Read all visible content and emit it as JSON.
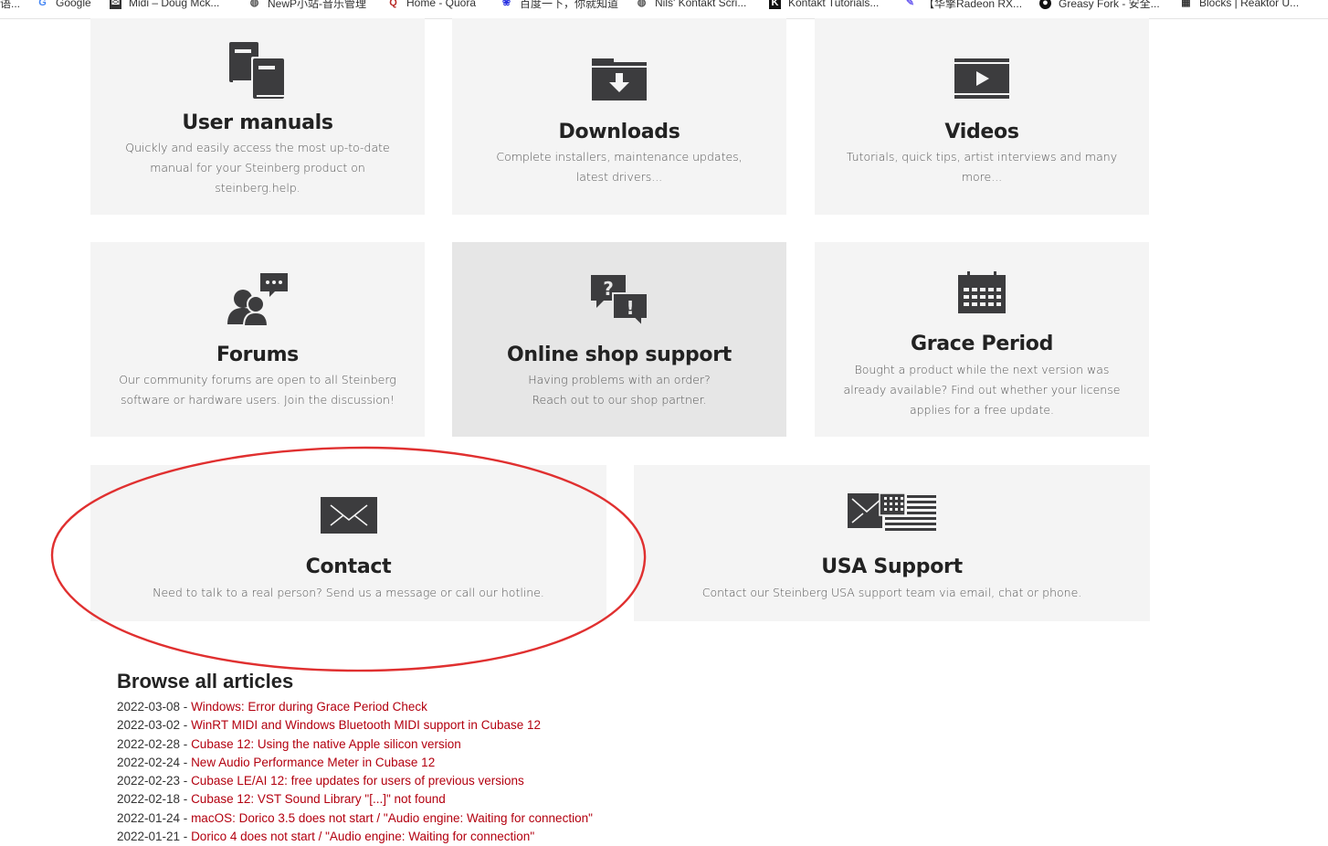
{
  "bookmarks": [
    {
      "icon": "generic-icon",
      "label": "语..."
    },
    {
      "icon": "google-icon",
      "label": "Google"
    },
    {
      "icon": "mail-icon",
      "label": "Midi – Doug Mck..."
    },
    {
      "icon": "globe-icon",
      "label": "NewP小站-音乐管理"
    },
    {
      "icon": "quora-icon",
      "label": "Home - Quora"
    },
    {
      "icon": "paw-icon",
      "label": "百度一下，你就知道"
    },
    {
      "icon": "globe-icon",
      "label": "Nils' Kontakt Scri..."
    },
    {
      "icon": "kontakt-icon",
      "label": "Kontakt Tutorials..."
    },
    {
      "icon": "pen-icon",
      "label": "【华擎Radeon RX..."
    },
    {
      "icon": "monkey-icon",
      "label": "Greasy Fork - 安全..."
    },
    {
      "icon": "blocks-icon",
      "label": "Blocks | Reaktor U..."
    }
  ],
  "cards": {
    "user_manuals": {
      "title": "User manuals",
      "desc": "Quickly and easily access the most up-to-date manual for your Steinberg product on steinberg.help."
    },
    "downloads": {
      "title": "Downloads",
      "desc": "Complete installers, maintenance updates, latest drivers..."
    },
    "videos": {
      "title": "Videos",
      "desc": "Tutorials, quick tips, artist interviews and many more..."
    },
    "forums": {
      "title": "Forums",
      "desc": "Our community forums are open to all Steinberg software or hardware users. Join the discussion!"
    },
    "shop": {
      "title": "Online shop support",
      "desc": "Having problems with an order? Reach out to our shop partner."
    },
    "grace": {
      "title": "Grace Period",
      "desc": "Bought a product while the next version was already available? Find out whether your license applies for a free update."
    },
    "contact": {
      "title": "Contact",
      "desc": "Need to talk to a real person? Send us a message or call our hotline."
    },
    "usa": {
      "title": "USA Support",
      "desc": "Contact our Steinberg USA support team via email, chat or phone."
    }
  },
  "articles": {
    "heading": "Browse all articles",
    "items": [
      {
        "date": "2022-03-08 - ",
        "title": "Windows: Error during Grace Period Check"
      },
      {
        "date": "2022-03-02 - ",
        "title": "WinRT MIDI and Windows Bluetooth MIDI support in Cubase 12"
      },
      {
        "date": "2022-02-28 - ",
        "title": "Cubase 12: Using the native Apple silicon version"
      },
      {
        "date": "2022-02-24 - ",
        "title": "New Audio Performance Meter in Cubase 12"
      },
      {
        "date": "2022-02-23 - ",
        "title": "Cubase LE/AI 12: free updates for users of previous versions"
      },
      {
        "date": "2022-02-18 - ",
        "title": "Cubase 12: VST Sound Library \"[...]\" not found"
      },
      {
        "date": "2022-01-24 - ",
        "title": "macOS: Dorico 3.5 does not start / \"Audio engine: Waiting for connection\""
      },
      {
        "date": "2022-01-21 - ",
        "title": "Dorico 4 does not start / \"Audio engine: Waiting for connection\""
      }
    ]
  },
  "colors": {
    "card_bg": "#f4f4f4",
    "card_hover": "#e6e6e6",
    "icon": "#3c3c3e",
    "link": "#b3000f",
    "annotation": "#e03030"
  }
}
